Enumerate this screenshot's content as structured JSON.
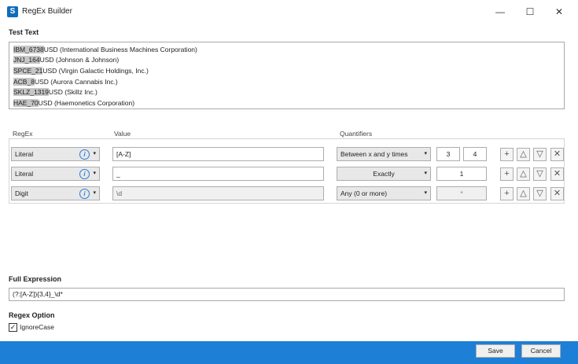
{
  "window": {
    "title": "RegEx Builder",
    "minimize_glyph": "—",
    "maximize_glyph": "☐",
    "close_glyph": "✕",
    "app_icon": "regex-builder-app-icon"
  },
  "test_text": {
    "heading": "Test Text",
    "lines": [
      {
        "match": "IBM_6738",
        "rest": "USD (International Business Machines Corporation)"
      },
      {
        "match": "JNJ_164",
        "rest": "USD (Johnson & Johnson)"
      },
      {
        "match": "SPCE_21",
        "rest": "USD (Virgin Galactic Holdings, Inc.)"
      },
      {
        "match": "ACB_8",
        "rest": "USD (Aurora Cannabis Inc.)"
      },
      {
        "match": "SKLZ_1319",
        "rest": "USD (Skillz Inc.)"
      },
      {
        "match": "HAE_70",
        "rest": "USD (Haemonetics Corporation)"
      }
    ],
    "highlight_color": "#c6c6c6"
  },
  "regex_table": {
    "headers": {
      "regex": "RegEx",
      "value": "Value",
      "quantifiers": "Quantifiers"
    },
    "rows": [
      {
        "type": "Literal",
        "value": "[A-Z]",
        "value_disabled": false,
        "quantifier": "Between x and y times",
        "min": "3",
        "max": "4",
        "min_disabled": false
      },
      {
        "type": "Literal",
        "value": "_",
        "value_disabled": false,
        "quantifier": "Exactly",
        "min": "",
        "max": "1",
        "min_disabled": false
      },
      {
        "type": "Digit",
        "value": "\\d",
        "value_disabled": true,
        "quantifier": "Any (0 or more)",
        "min": "",
        "max": "*",
        "min_disabled": true
      }
    ],
    "info_glyph": "i",
    "caret_glyph": "▾",
    "action_icons": {
      "add": "+",
      "up": "△",
      "down": "▽",
      "remove": "✕"
    }
  },
  "full_expression": {
    "heading": "Full Expression",
    "value": "(?:[A-Z]){3,4}_\\d*"
  },
  "regex_option": {
    "heading": "Regex Option",
    "ignore_case_label": "IgnoreCase",
    "ignore_case_checked": true,
    "check_glyph": "✓"
  },
  "footer": {
    "save_label": "Save",
    "cancel_label": "Cancel",
    "accent_color": "#1e7fd6"
  }
}
